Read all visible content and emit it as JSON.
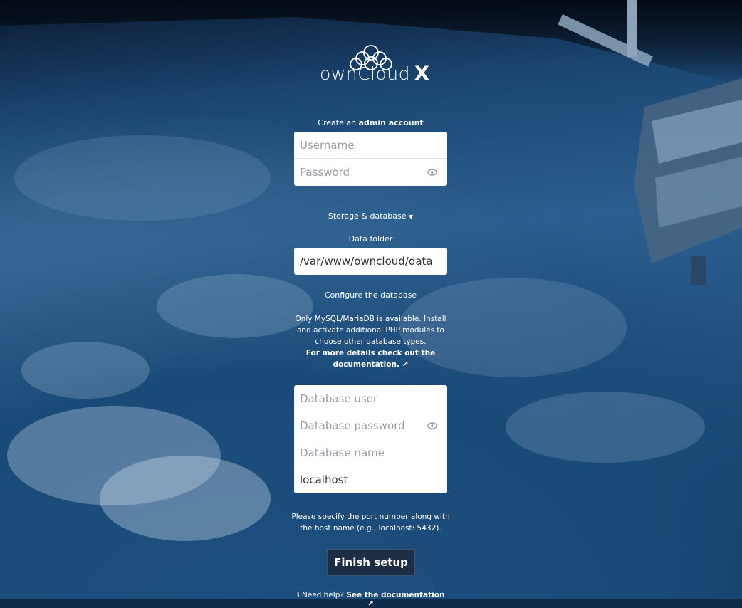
{
  "brand": {
    "name": "ownCloud",
    "edition": "X"
  },
  "admin": {
    "heading_prefix": "Create an",
    "heading_bold": "admin account",
    "username_placeholder": "Username",
    "password_placeholder": "Password"
  },
  "storage": {
    "toggle_label": "Storage & database",
    "data_folder_label": "Data folder",
    "data_folder_value": "/var/www/owncloud/data"
  },
  "database": {
    "heading": "Configure the database",
    "info_text": "Only MySQL/MariaDB is available. Install and activate additional PHP modules to choose other database types.",
    "info_link": "For more details check out the documentation. ↗",
    "user_placeholder": "Database user",
    "password_placeholder": "Database password",
    "name_placeholder": "Database name",
    "host_value": "localhost",
    "host_hint": "Please specify the port number along with the host name (e.g., localhost: 5432)."
  },
  "actions": {
    "finish_label": "Finish setup"
  },
  "help": {
    "icon": "info-icon",
    "prefix": "Need help?",
    "link": "See the documentation ↗"
  },
  "colors": {
    "button_bg": "#1d2d44",
    "background": "#1b4672"
  }
}
